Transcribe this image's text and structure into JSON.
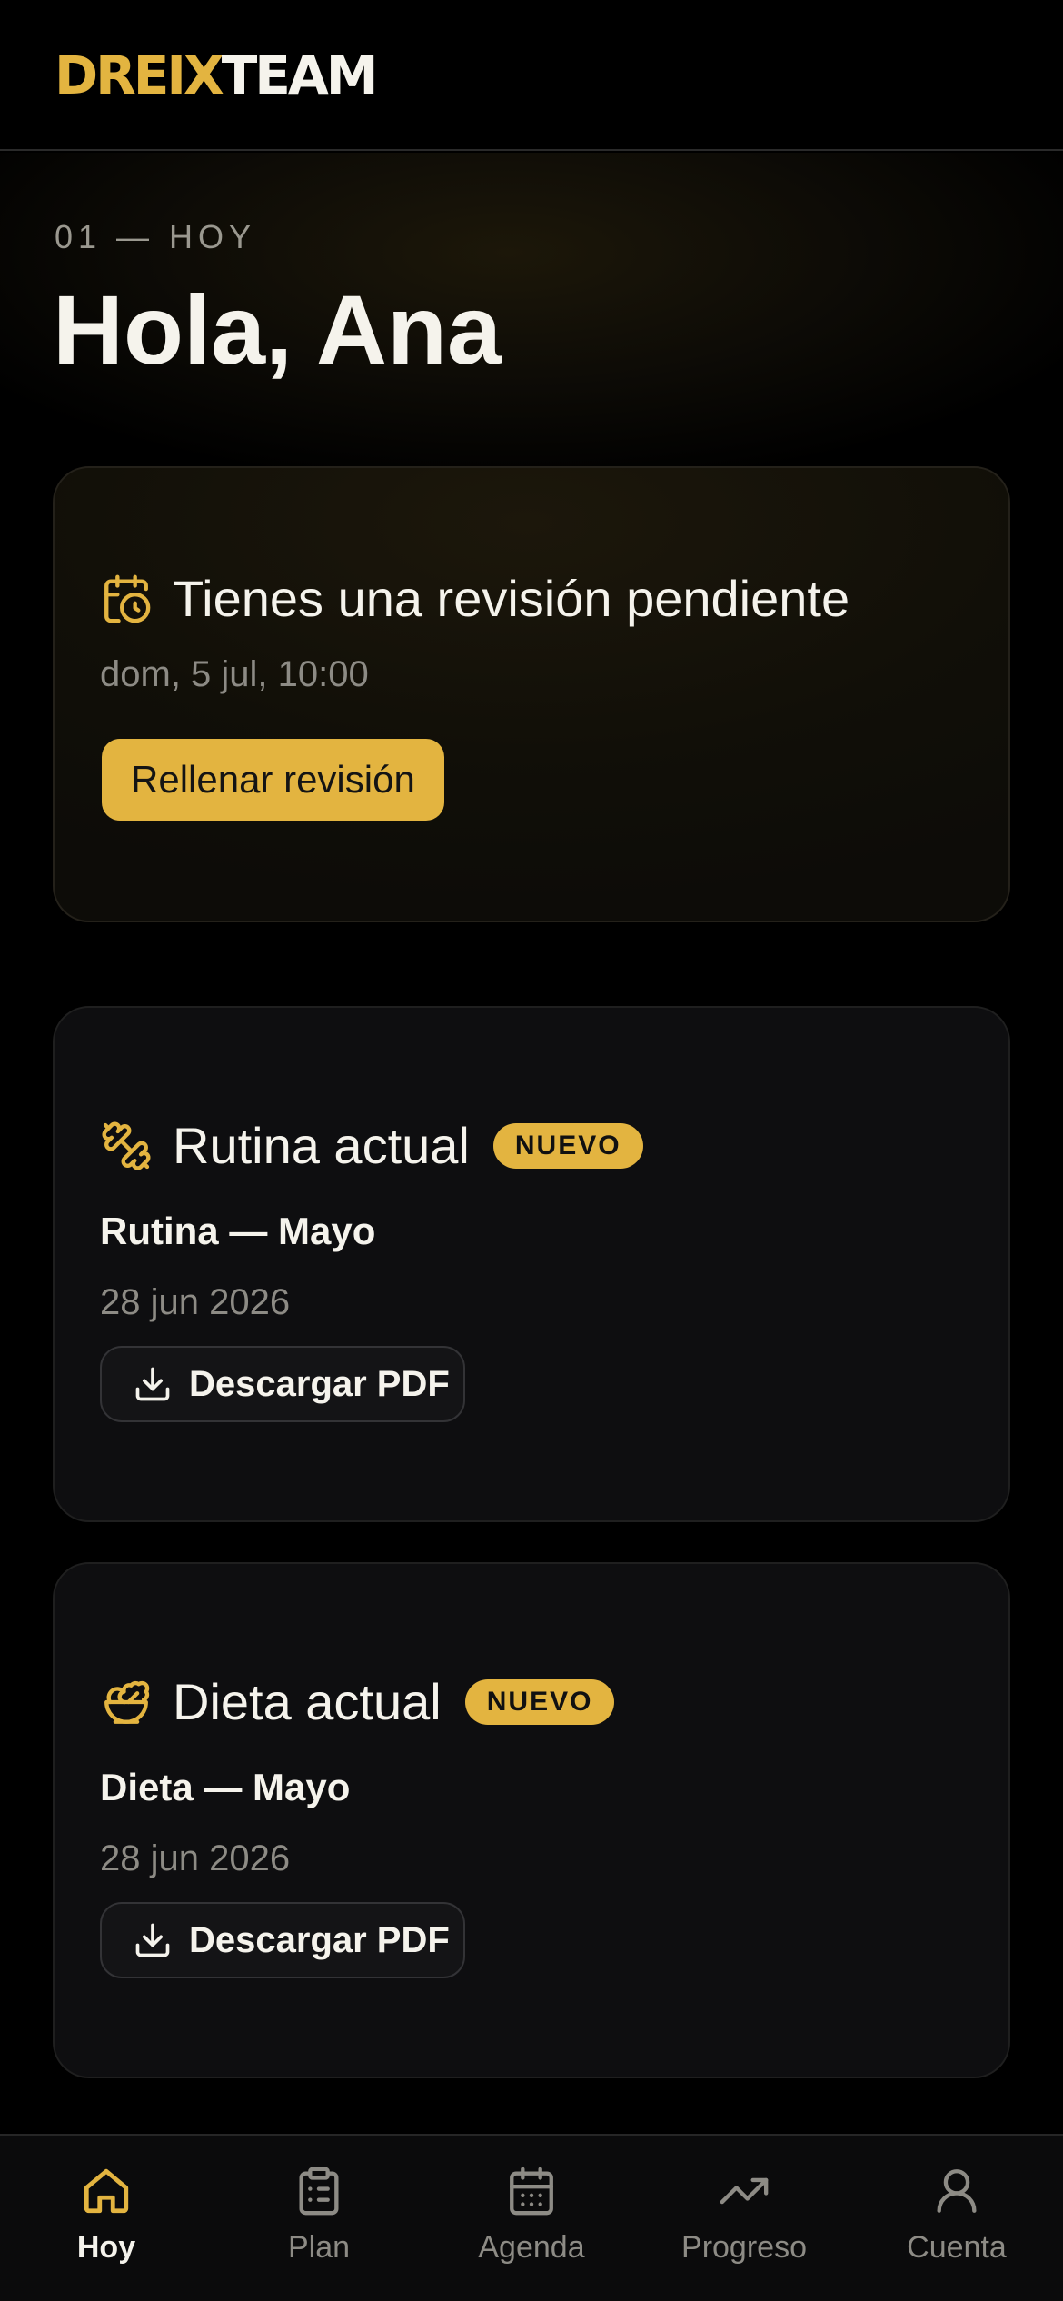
{
  "app": {
    "logo_part1": "DREIX",
    "logo_part2": "TEAM"
  },
  "hero": {
    "eyebrow": "01 — HOY",
    "greeting": "Hola, Ana"
  },
  "review_card": {
    "title": "Tienes una revisión pendiente",
    "date": "dom, 5 jul, 10:00",
    "button_label": "Rellenar revisión",
    "icon": "calendar-clock-icon"
  },
  "rutina_card": {
    "title": "Rutina actual",
    "badge": "NUEVO",
    "plan_name": "Rutina — Mayo",
    "date": "28 jun 2026",
    "button_label": "Descargar PDF",
    "icon": "dumbbell-icon"
  },
  "dieta_card": {
    "title": "Dieta actual",
    "badge": "NUEVO",
    "plan_name": "Dieta — Mayo",
    "date": "28 jun 2026",
    "button_label": "Descargar PDF",
    "icon": "salad-bowl-icon"
  },
  "nav": {
    "items": [
      {
        "label": "Hoy",
        "icon": "home-icon",
        "active": true
      },
      {
        "label": "Plan",
        "icon": "clipboard-icon",
        "active": false
      },
      {
        "label": "Agenda",
        "icon": "calendar-icon",
        "active": false
      },
      {
        "label": "Progreso",
        "icon": "trending-up-icon",
        "active": false
      },
      {
        "label": "Cuenta",
        "icon": "user-icon",
        "active": false
      }
    ]
  },
  "colors": {
    "accent": "#e3b440",
    "background": "#000000",
    "card": "#0e0e10",
    "text": "#f5f3ec",
    "muted": "#8d8b85"
  }
}
